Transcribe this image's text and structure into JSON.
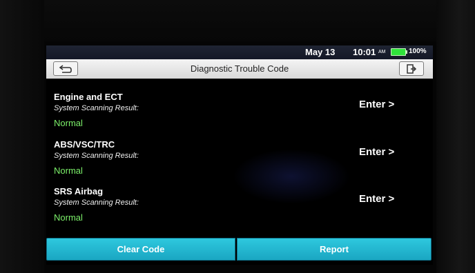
{
  "status_bar": {
    "date": "May 13",
    "time": "10:01",
    "ampm": "AM",
    "battery_percent": "100%",
    "battery_level": 1.0,
    "battery_color": "#2fe23a"
  },
  "header": {
    "title": "Diagnostic Trouble Code",
    "back_icon": "back-arrow-icon",
    "exit_icon": "exit-door-icon"
  },
  "systems": [
    {
      "name": "Engine and ECT",
      "subtitle": "System Scanning Result:",
      "status": "Normal",
      "action": "Enter >"
    },
    {
      "name": "ABS/VSC/TRC",
      "subtitle": "System Scanning Result:",
      "status": "Normal",
      "action": "Enter >"
    },
    {
      "name": "SRS Airbag",
      "subtitle": "System Scanning Result:",
      "status": "Normal",
      "action": "Enter >"
    }
  ],
  "footer": {
    "clear_code": "Clear Code",
    "report": "Report"
  },
  "colors": {
    "status_normal": "#7cf06a",
    "button_accent": "#1fb3cc"
  }
}
